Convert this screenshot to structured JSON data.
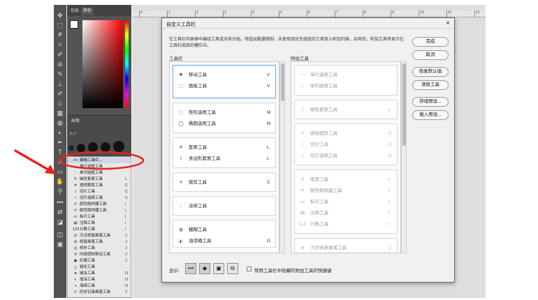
{
  "panel": {
    "tabs": [
      "色板",
      "颜色"
    ],
    "brush_tab": "画笔",
    "brush_size_label": "大小:"
  },
  "tools_icons": [
    "move-icon",
    "marquee-icon",
    "lasso-icon",
    "crop-icon",
    "eyedropper-icon",
    "healing-icon",
    "brush-icon",
    "stamp-icon",
    "history-brush-icon",
    "eraser-icon",
    "gradient-icon",
    "blur-icon",
    "dodge-icon",
    "pen-icon",
    "type-icon",
    "path-select-icon",
    "rect-shape-icon",
    "hand-icon",
    "zoom-icon",
    "edit-toolbar-icon",
    "swap-colors-icon",
    "fg-bg-icon",
    "quickmask-icon",
    "screenmode-icon"
  ],
  "flyout": {
    "items": [
      {
        "icon": "•••",
        "name": "编辑工具栏...",
        "key": ""
      },
      {
        "icon": "⋯",
        "name": "单行选框工具",
        "key": ""
      },
      {
        "icon": "⋮",
        "name": "单列选框工具",
        "key": ""
      },
      {
        "icon": "✎",
        "name": "磁性套索工具",
        "key": "L"
      },
      {
        "icon": "⌗",
        "name": "透视裁剪工具",
        "key": "C"
      },
      {
        "icon": "/",
        "name": "切片工具",
        "key": "C"
      },
      {
        "icon": "/",
        "name": "切片选择工具",
        "key": "C"
      },
      {
        "icon": "✐",
        "name": "颜色取样器工具",
        "key": "I"
      },
      {
        "icon": "✐",
        "name": "颜色取样器工具",
        "key": "I"
      },
      {
        "icon": "▭",
        "name": "标尺工具",
        "key": "I"
      },
      {
        "icon": "▤",
        "name": "注释工具",
        "key": "I"
      },
      {
        "icon": "123",
        "name": "计数工具",
        "key": "I"
      },
      {
        "icon": "⊘",
        "name": "污点修复画笔工具",
        "key": "J"
      },
      {
        "icon": "⊘",
        "name": "修复画笔工具",
        "key": "J"
      },
      {
        "icon": "◎",
        "name": "修补工具",
        "key": "J"
      },
      {
        "icon": "✕",
        "name": "内容感知移动工具",
        "key": "J"
      },
      {
        "icon": "◉",
        "name": "红眼工具",
        "key": "J"
      },
      {
        "icon": "△",
        "name": "锐化工具",
        "key": ""
      },
      {
        "icon": "●",
        "name": "减淡工具",
        "key": "O"
      },
      {
        "icon": "◐",
        "name": "加深工具",
        "key": "O"
      },
      {
        "icon": "◑",
        "name": "海绵工具",
        "key": "O"
      },
      {
        "icon": "✐",
        "name": "历史记录画笔工具",
        "key": "Y"
      }
    ]
  },
  "ruler_ticks": [
    "0",
    "1",
    "2",
    "3",
    "4",
    "5",
    "6",
    "7",
    "8",
    "9",
    "10",
    "11",
    "12"
  ],
  "dialog": {
    "title": "自定义工具栏",
    "close": "×",
    "description": "在工具栏列表框中编组工具或对其分组。将超出数量限制、未使用或优先级低的工具放入附加列表。启用后，附加工具将显示在工具栏底部的槽位中。",
    "toolbar_heading": "工具栏",
    "extra_heading": "附加工具",
    "toolbar_groups": [
      {
        "items": [
          {
            "icon": "✥",
            "name": "移动工具",
            "key": "V"
          },
          {
            "icon": "⬚",
            "name": "画板工具",
            "key": "V"
          }
        ]
      },
      {
        "items": [
          {
            "icon": "⬚",
            "name": "矩形选框工具",
            "key": "M"
          },
          {
            "icon": "◯",
            "name": "椭圆选框工具",
            "key": "M"
          }
        ]
      },
      {
        "items": [
          {
            "icon": "ᑭ",
            "name": "套索工具",
            "key": "L"
          },
          {
            "icon": "⌇",
            "name": "多边形套索工具",
            "key": "L"
          }
        ]
      },
      {
        "items": [
          {
            "icon": "⌗",
            "name": "裁剪工具",
            "key": "C"
          }
        ]
      },
      {
        "items": [
          {
            "icon": "◌",
            "name": "涂抹工具",
            "key": ""
          }
        ]
      },
      {
        "items": [
          {
            "icon": "◍",
            "name": "模糊工具",
            "key": ""
          },
          {
            "icon": "◭",
            "name": "油漆桶工具",
            "key": "G"
          }
        ]
      }
    ],
    "extra_groups": [
      {
        "items": [
          {
            "icon": "⋯",
            "name": "单行选框工具",
            "key": ""
          },
          {
            "icon": "⋮",
            "name": "单列选框工具",
            "key": ""
          }
        ]
      },
      {
        "items": [
          {
            "icon": "⌇",
            "name": "磁性套索工具",
            "key": "L"
          }
        ]
      },
      {
        "items": [
          {
            "icon": "⌗",
            "name": "透视裁剪工具",
            "key": "C"
          },
          {
            "icon": "/",
            "name": "切片工具",
            "key": "C"
          },
          {
            "icon": "/",
            "name": "切片选择工具",
            "key": "C"
          }
        ]
      },
      {
        "items": [
          {
            "icon": "✐",
            "name": "吸管工具",
            "key": "I"
          },
          {
            "icon": "✐",
            "name": "颜色取样器工具",
            "key": "I"
          },
          {
            "icon": "▭",
            "name": "标尺工具",
            "key": "I"
          },
          {
            "icon": "▤",
            "name": "注释工具",
            "key": "I"
          },
          {
            "icon": "1₂3",
            "name": "计数工具",
            "key": "I"
          }
        ]
      },
      {
        "items": [
          {
            "icon": "⊘",
            "name": "污点修复画笔工具",
            "key": "J"
          },
          {
            "icon": "⊘",
            "name": "修复画笔工具",
            "key": "J"
          }
        ]
      }
    ],
    "buttons": {
      "done": "完成",
      "cancel": "取消",
      "restore": "恢复默认值",
      "clear": "清除工具",
      "save": "存储预设...",
      "load": "载入预设..."
    },
    "footer": {
      "show_label": "显示:",
      "btn_icons": [
        "•••",
        "◆",
        "▣",
        "⧉"
      ],
      "checkbox_label": "禁用工具栏中隐藏的附加工具的快捷键"
    }
  }
}
